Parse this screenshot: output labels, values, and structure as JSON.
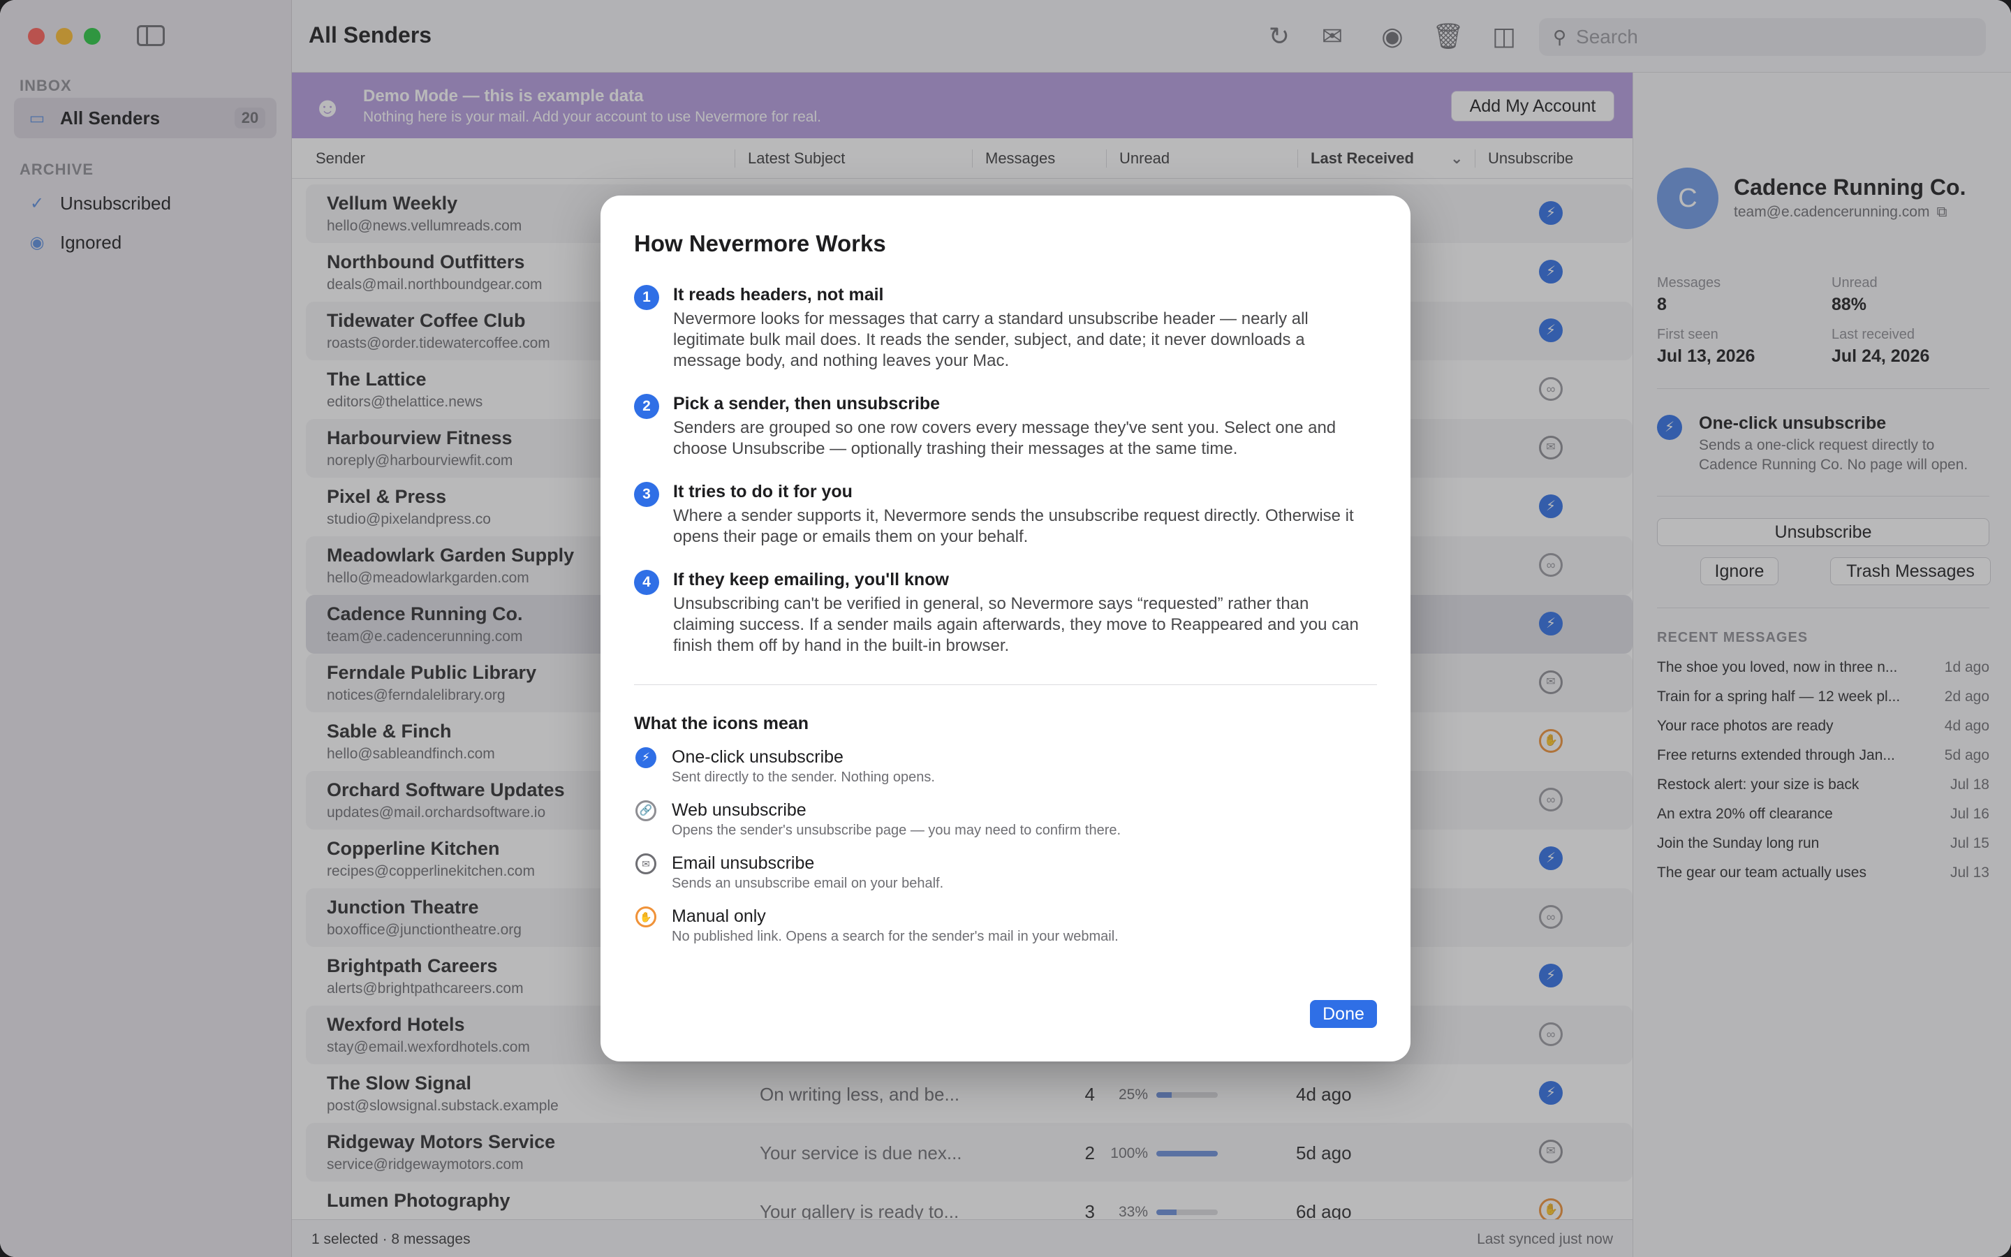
{
  "window": {
    "title": "All Senders"
  },
  "sidebar": {
    "inbox_header": "INBOX",
    "archive_header": "ARCHIVE",
    "all_senders": {
      "label": "All Senders",
      "count": "20"
    },
    "unsubscribed": "Unsubscribed",
    "ignored": "Ignored"
  },
  "toolbar": {
    "search_placeholder": "Search"
  },
  "banner": {
    "title": "Demo Mode — this is example data",
    "subtitle": "Nothing here is your mail. Add your account to use Nevermore for real.",
    "button": "Add My Account"
  },
  "table": {
    "headers": {
      "sender": "Sender",
      "subject": "Latest Subject",
      "messages": "Messages",
      "unread": "Unread",
      "received": "Last Received",
      "unsubscribe": "Unsubscribe"
    },
    "rows": [
      {
        "name": "Vellum Weekly",
        "email": "hello@news.vellumreads.com",
        "subject": "",
        "count": "",
        "pct": "",
        "unread_fraction": 0,
        "received": "",
        "method": "one-click"
      },
      {
        "name": "Northbound Outfitters",
        "email": "deals@mail.northboundgear.com",
        "subject": "",
        "count": "",
        "pct": "",
        "unread_fraction": 0,
        "received": "",
        "method": "one-click"
      },
      {
        "name": "Tidewater Coffee Club",
        "email": "roasts@order.tidewatercoffee.com",
        "subject": "",
        "count": "",
        "pct": "",
        "unread_fraction": 0,
        "received": "",
        "method": "one-click"
      },
      {
        "name": "The Lattice",
        "email": "editors@thelattice.news",
        "subject": "",
        "count": "",
        "pct": "",
        "unread_fraction": 0,
        "received": "",
        "method": "web"
      },
      {
        "name": "Harbourview Fitness",
        "email": "noreply@harbourviewfit.com",
        "subject": "",
        "count": "",
        "pct": "",
        "unread_fraction": 0,
        "received": "",
        "method": "email"
      },
      {
        "name": "Pixel & Press",
        "email": "studio@pixelandpress.co",
        "subject": "",
        "count": "",
        "pct": "",
        "unread_fraction": 0,
        "received": "",
        "method": "one-click"
      },
      {
        "name": "Meadowlark Garden Supply",
        "email": "hello@meadowlarkgarden.com",
        "subject": "",
        "count": "",
        "pct": "",
        "unread_fraction": 0,
        "received": "",
        "method": "web"
      },
      {
        "name": "Cadence Running Co.",
        "email": "team@e.cadencerunning.com",
        "subject": "",
        "count": "",
        "pct": "",
        "unread_fraction": 0,
        "received": "",
        "method": "one-click"
      },
      {
        "name": "Ferndale Public Library",
        "email": "notices@ferndalelibrary.org",
        "subject": "",
        "count": "",
        "pct": "",
        "unread_fraction": 0,
        "received": "",
        "method": "email"
      },
      {
        "name": "Sable & Finch",
        "email": "hello@sableandfinch.com",
        "subject": "",
        "count": "",
        "pct": "",
        "unread_fraction": 0,
        "received": "",
        "method": "manual"
      },
      {
        "name": "Orchard Software Updates",
        "email": "updates@mail.orchardsoftware.io",
        "subject": "",
        "count": "",
        "pct": "",
        "unread_fraction": 0,
        "received": "",
        "method": "web"
      },
      {
        "name": "Copperline Kitchen",
        "email": "recipes@copperlinekitchen.com",
        "subject": "",
        "count": "",
        "pct": "",
        "unread_fraction": 0,
        "received": "",
        "method": "one-click"
      },
      {
        "name": "Junction Theatre",
        "email": "boxoffice@junctiontheatre.org",
        "subject": "",
        "count": "",
        "pct": "",
        "unread_fraction": 0,
        "received": "",
        "method": "web"
      },
      {
        "name": "Brightpath Careers",
        "email": "alerts@brightpathcareers.com",
        "subject": "",
        "count": "",
        "pct": "",
        "unread_fraction": 0,
        "received": "",
        "method": "one-click"
      },
      {
        "name": "Wexford Hotels",
        "email": "stay@email.wexfordhotels.com",
        "subject": "",
        "count": "",
        "pct": "",
        "unread_fraction": 0,
        "received": "",
        "method": "web"
      },
      {
        "name": "The Slow Signal",
        "email": "post@slowsignal.substack.example",
        "subject": "On writing less, and be...",
        "count": "4",
        "pct": "25%",
        "unread_fraction": 0.25,
        "received": "4d ago",
        "method": "one-click"
      },
      {
        "name": "Ridgeway Motors Service",
        "email": "service@ridgewaymotors.com",
        "subject": "Your service is due nex...",
        "count": "2",
        "pct": "100%",
        "unread_fraction": 1.0,
        "received": "5d ago",
        "method": "email"
      },
      {
        "name": "Lumen Photography",
        "email": "",
        "subject": "Your gallery is ready to...",
        "count": "3",
        "pct": "33%",
        "unread_fraction": 0.33,
        "received": "6d ago",
        "method": "manual"
      }
    ]
  },
  "statusbar": {
    "left": "1 selected · 8 messages",
    "right": "Last synced just now"
  },
  "inspector": {
    "avatar_letter": "C",
    "name": "Cadence Running Co.",
    "email": "team@e.cadencerunning.com",
    "stats": {
      "messages_label": "Messages",
      "messages_value": "8",
      "unread_label": "Unread",
      "unread_value": "88%",
      "first_seen_label": "First seen",
      "first_seen_value": "Jul 13, 2026",
      "last_received_label": "Last received",
      "last_received_value": "Jul 24, 2026"
    },
    "method_title": "One-click unsubscribe",
    "method_desc": "Sends a one-click request directly to Cadence Running Co. No page will open.",
    "unsubscribe_button": "Unsubscribe",
    "ignore_button": "Ignore",
    "trash_button": "Trash Messages",
    "recent_header": "RECENT MESSAGES",
    "recent": [
      {
        "subject": "The shoe you loved, now in three n...",
        "age": "1d ago"
      },
      {
        "subject": "Train for a spring half — 12 week pl...",
        "age": "2d ago"
      },
      {
        "subject": "Your race photos are ready",
        "age": "4d ago"
      },
      {
        "subject": "Free returns extended through Jan...",
        "age": "5d ago"
      },
      {
        "subject": "Restock alert: your size is back",
        "age": "Jul 18"
      },
      {
        "subject": "An extra 20% off clearance",
        "age": "Jul 16"
      },
      {
        "subject": "Join the Sunday long run",
        "age": "Jul 15"
      },
      {
        "subject": "The gear our team actually uses",
        "age": "Jul 13"
      }
    ]
  },
  "modal": {
    "title": "How Nevermore Works",
    "steps": [
      {
        "num": "1",
        "title": "It reads headers, not mail",
        "body": "Nevermore looks for messages that carry a standard unsubscribe header — nearly all legitimate bulk mail does. It reads the sender, subject, and date; it never downloads a message body, and nothing leaves your Mac."
      },
      {
        "num": "2",
        "title": "Pick a sender, then unsubscribe",
        "body": "Senders are grouped so one row covers every message they've sent you. Select one and choose Unsubscribe — optionally trashing their messages at the same time."
      },
      {
        "num": "3",
        "title": "It tries to do it for you",
        "body": "Where a sender supports it, Nevermore sends the unsubscribe request directly. Otherwise it opens their page or emails them on your behalf."
      },
      {
        "num": "4",
        "title": "If they keep emailing, you'll know",
        "body": "Unsubscribing can't be verified in general, so Nevermore says “requested” rather than claiming success. If a sender mails again afterwards, they move to Reappeared and you can finish them off by hand in the built-in browser."
      }
    ],
    "icons_header": "What the icons mean",
    "legend": [
      {
        "icon": "bolt-icon",
        "title": "One-click unsubscribe",
        "desc": "Sent directly to the sender. Nothing opens."
      },
      {
        "icon": "link-icon",
        "title": "Web unsubscribe",
        "desc": "Opens the sender's unsubscribe page — you may need to confirm there."
      },
      {
        "icon": "envelope-icon",
        "title": "Email unsubscribe",
        "desc": "Sends an unsubscribe email on your behalf."
      },
      {
        "icon": "hand-icon",
        "title": "Manual only",
        "desc": "No published link. Opens a search for the sender's mail in your webmail."
      }
    ],
    "done_button": "Done"
  },
  "colors": {
    "accent": "#2f6fe6",
    "banner": "#b69de0",
    "manual": "#f09238"
  }
}
